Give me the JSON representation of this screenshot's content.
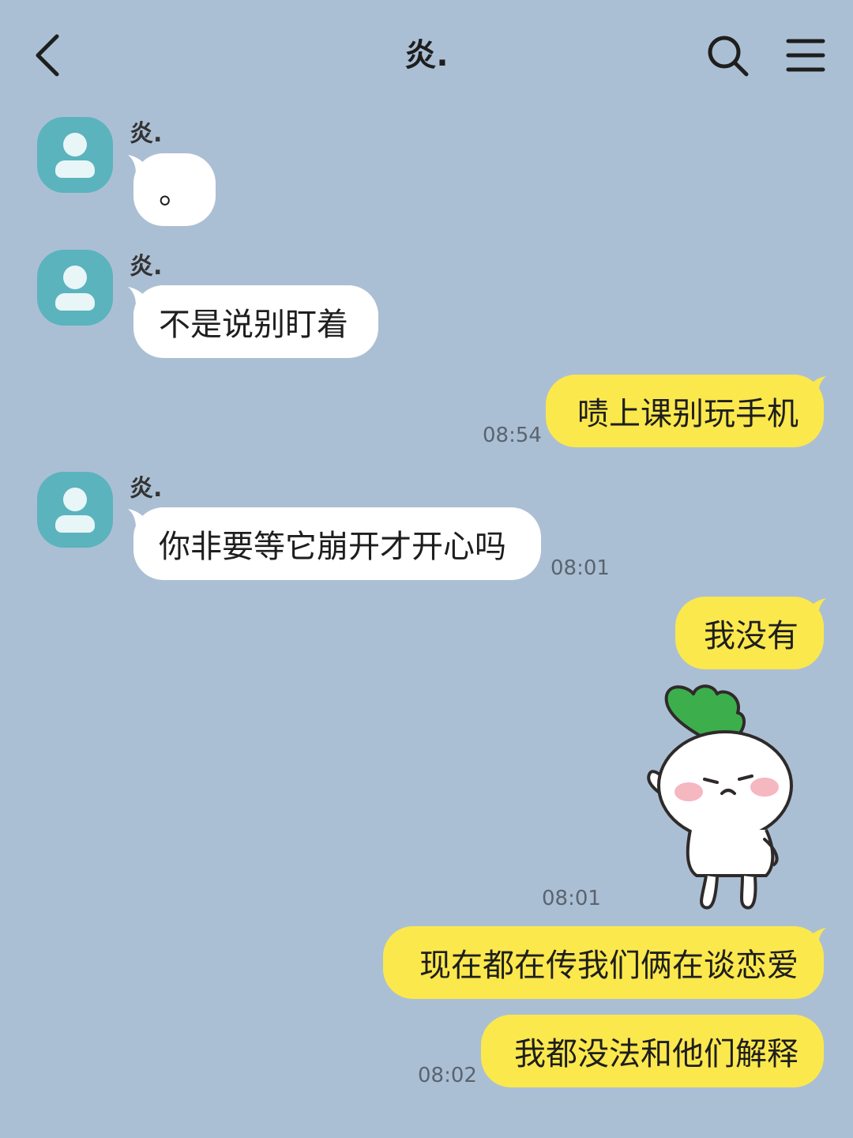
{
  "header": {
    "title": "炎."
  },
  "messages": [
    {
      "sender": "炎.",
      "text": "。"
    },
    {
      "sender": "炎.",
      "text": "不是说别盯着"
    },
    {
      "text": "啧上课别玩手机",
      "time": "08:54"
    },
    {
      "sender": "炎.",
      "text": "你非要等它崩开才开心吗",
      "time": "08:01"
    },
    {
      "text": "我没有"
    },
    {
      "sticker": "radish-sticker",
      "time": "08:01"
    },
    {
      "text": "现在都在传我们俩在谈恋爱"
    },
    {
      "text": "我都没法和他们解释",
      "time": "08:02"
    }
  ],
  "colors": {
    "background": "#abbfd4",
    "incoming_bubble": "#ffffff",
    "outgoing_bubble": "#fbe84d",
    "avatar": "#5bb3bd"
  },
  "icons": [
    "chevron-left-icon",
    "search-icon",
    "menu-icon",
    "avatar-icon",
    "radish-sticker"
  ]
}
